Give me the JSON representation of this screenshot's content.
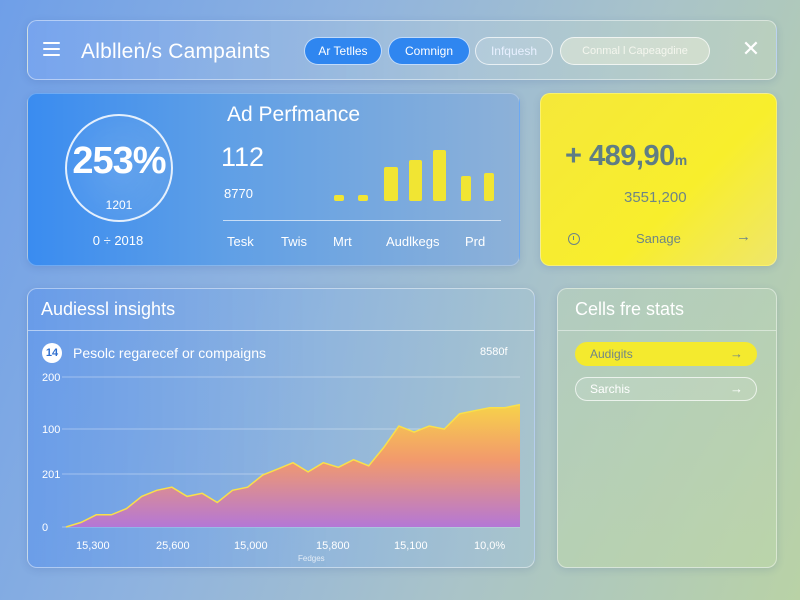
{
  "header": {
    "title": "Alblleṅ/s Campaints",
    "menu_icon": "hamburger-menu-icon",
    "pills": [
      "Ar Tetlles",
      "Comnign",
      "Infquesh",
      "Conmal l Capeagdine"
    ],
    "close_icon": "close-icon"
  },
  "ad_performance": {
    "ring_value": "253%",
    "ring_sub": "1201",
    "ring_caption": "0 ÷ 2018",
    "title": "Ad Perfmance",
    "metric": "112",
    "submetric": "8770",
    "bar_labels": [
      "Tesk",
      "Twis",
      "Mrt",
      "Audlkegs",
      "Prd"
    ],
    "bar_color": "#f1e533"
  },
  "total_card": {
    "value_prefix": "+",
    "value": "489,90",
    "value_unit": "m",
    "sub": "3551,200",
    "clock_icon": "clock-icon",
    "link": "Sanage",
    "arrow": "→",
    "background": "#f5e83a"
  },
  "insights": {
    "title": "Audiessl insights",
    "badge": "14",
    "subtitle": "Pesolc regarecef or compaigns",
    "corner_value": "8580f",
    "y_ticks": [
      "0",
      "201",
      "100",
      "200"
    ],
    "x_ticks": [
      "15,300",
      "25,600",
      "15,000",
      "15,800",
      "15,100",
      "10,0%"
    ],
    "x_axis_label": "Fedges",
    "chart_data": {
      "type": "area",
      "series": [
        {
          "values": [
            0,
            3,
            8,
            8,
            12,
            20,
            24,
            26,
            20,
            22,
            16,
            24,
            26,
            34,
            38,
            42,
            36,
            42,
            39,
            44,
            40,
            52,
            66,
            62,
            66,
            64,
            74,
            76,
            78,
            78,
            80
          ]
        }
      ],
      "ylim": [
        0,
        100
      ],
      "gradient": [
        "#f7d24a",
        "#f29a6c",
        "#b477d6"
      ]
    }
  },
  "cells_stats": {
    "title": "Cells fre stats",
    "items": [
      {
        "label": "Audigits",
        "arrow": "→"
      },
      {
        "label": "Sarchis",
        "arrow": "→"
      }
    ]
  }
}
